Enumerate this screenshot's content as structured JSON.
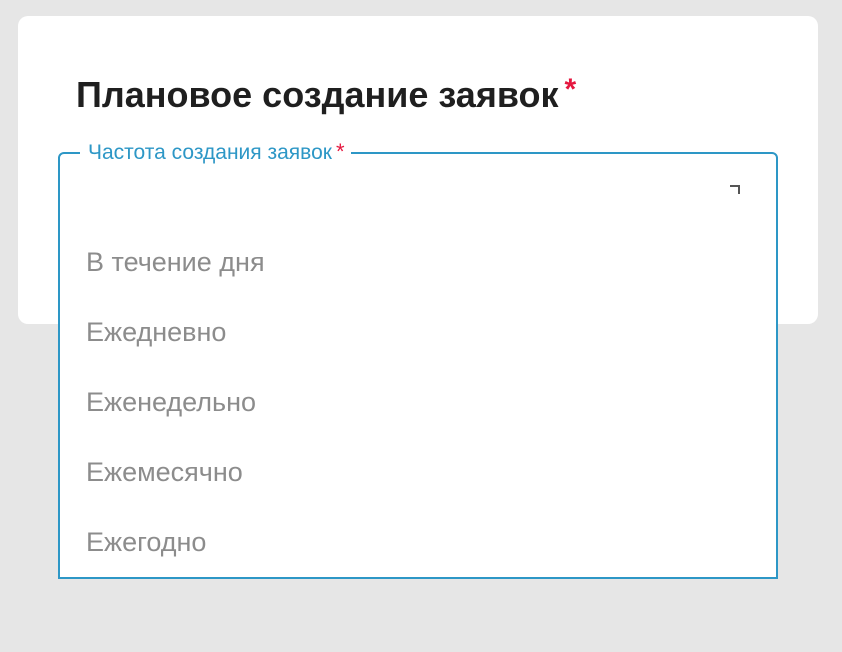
{
  "card": {
    "title": "Плановое создание заявок",
    "required_mark": "*"
  },
  "frequency_select": {
    "label": "Частота создания заявок",
    "required_mark": "*",
    "value": "",
    "expanded": true,
    "options": [
      {
        "label": "В течение дня"
      },
      {
        "label": "Ежедневно"
      },
      {
        "label": "Еженедельно"
      },
      {
        "label": "Ежемесячно"
      },
      {
        "label": "Ежегодно"
      }
    ]
  },
  "icons": {
    "dropdown_toggle": "chevron-icon"
  },
  "colors": {
    "accent": "#2d97c6",
    "required": "#e5173f",
    "title_text": "#1f1f1f",
    "option_text": "#8c8c8c",
    "page_background": "#e6e6e6",
    "card_background": "#ffffff"
  }
}
